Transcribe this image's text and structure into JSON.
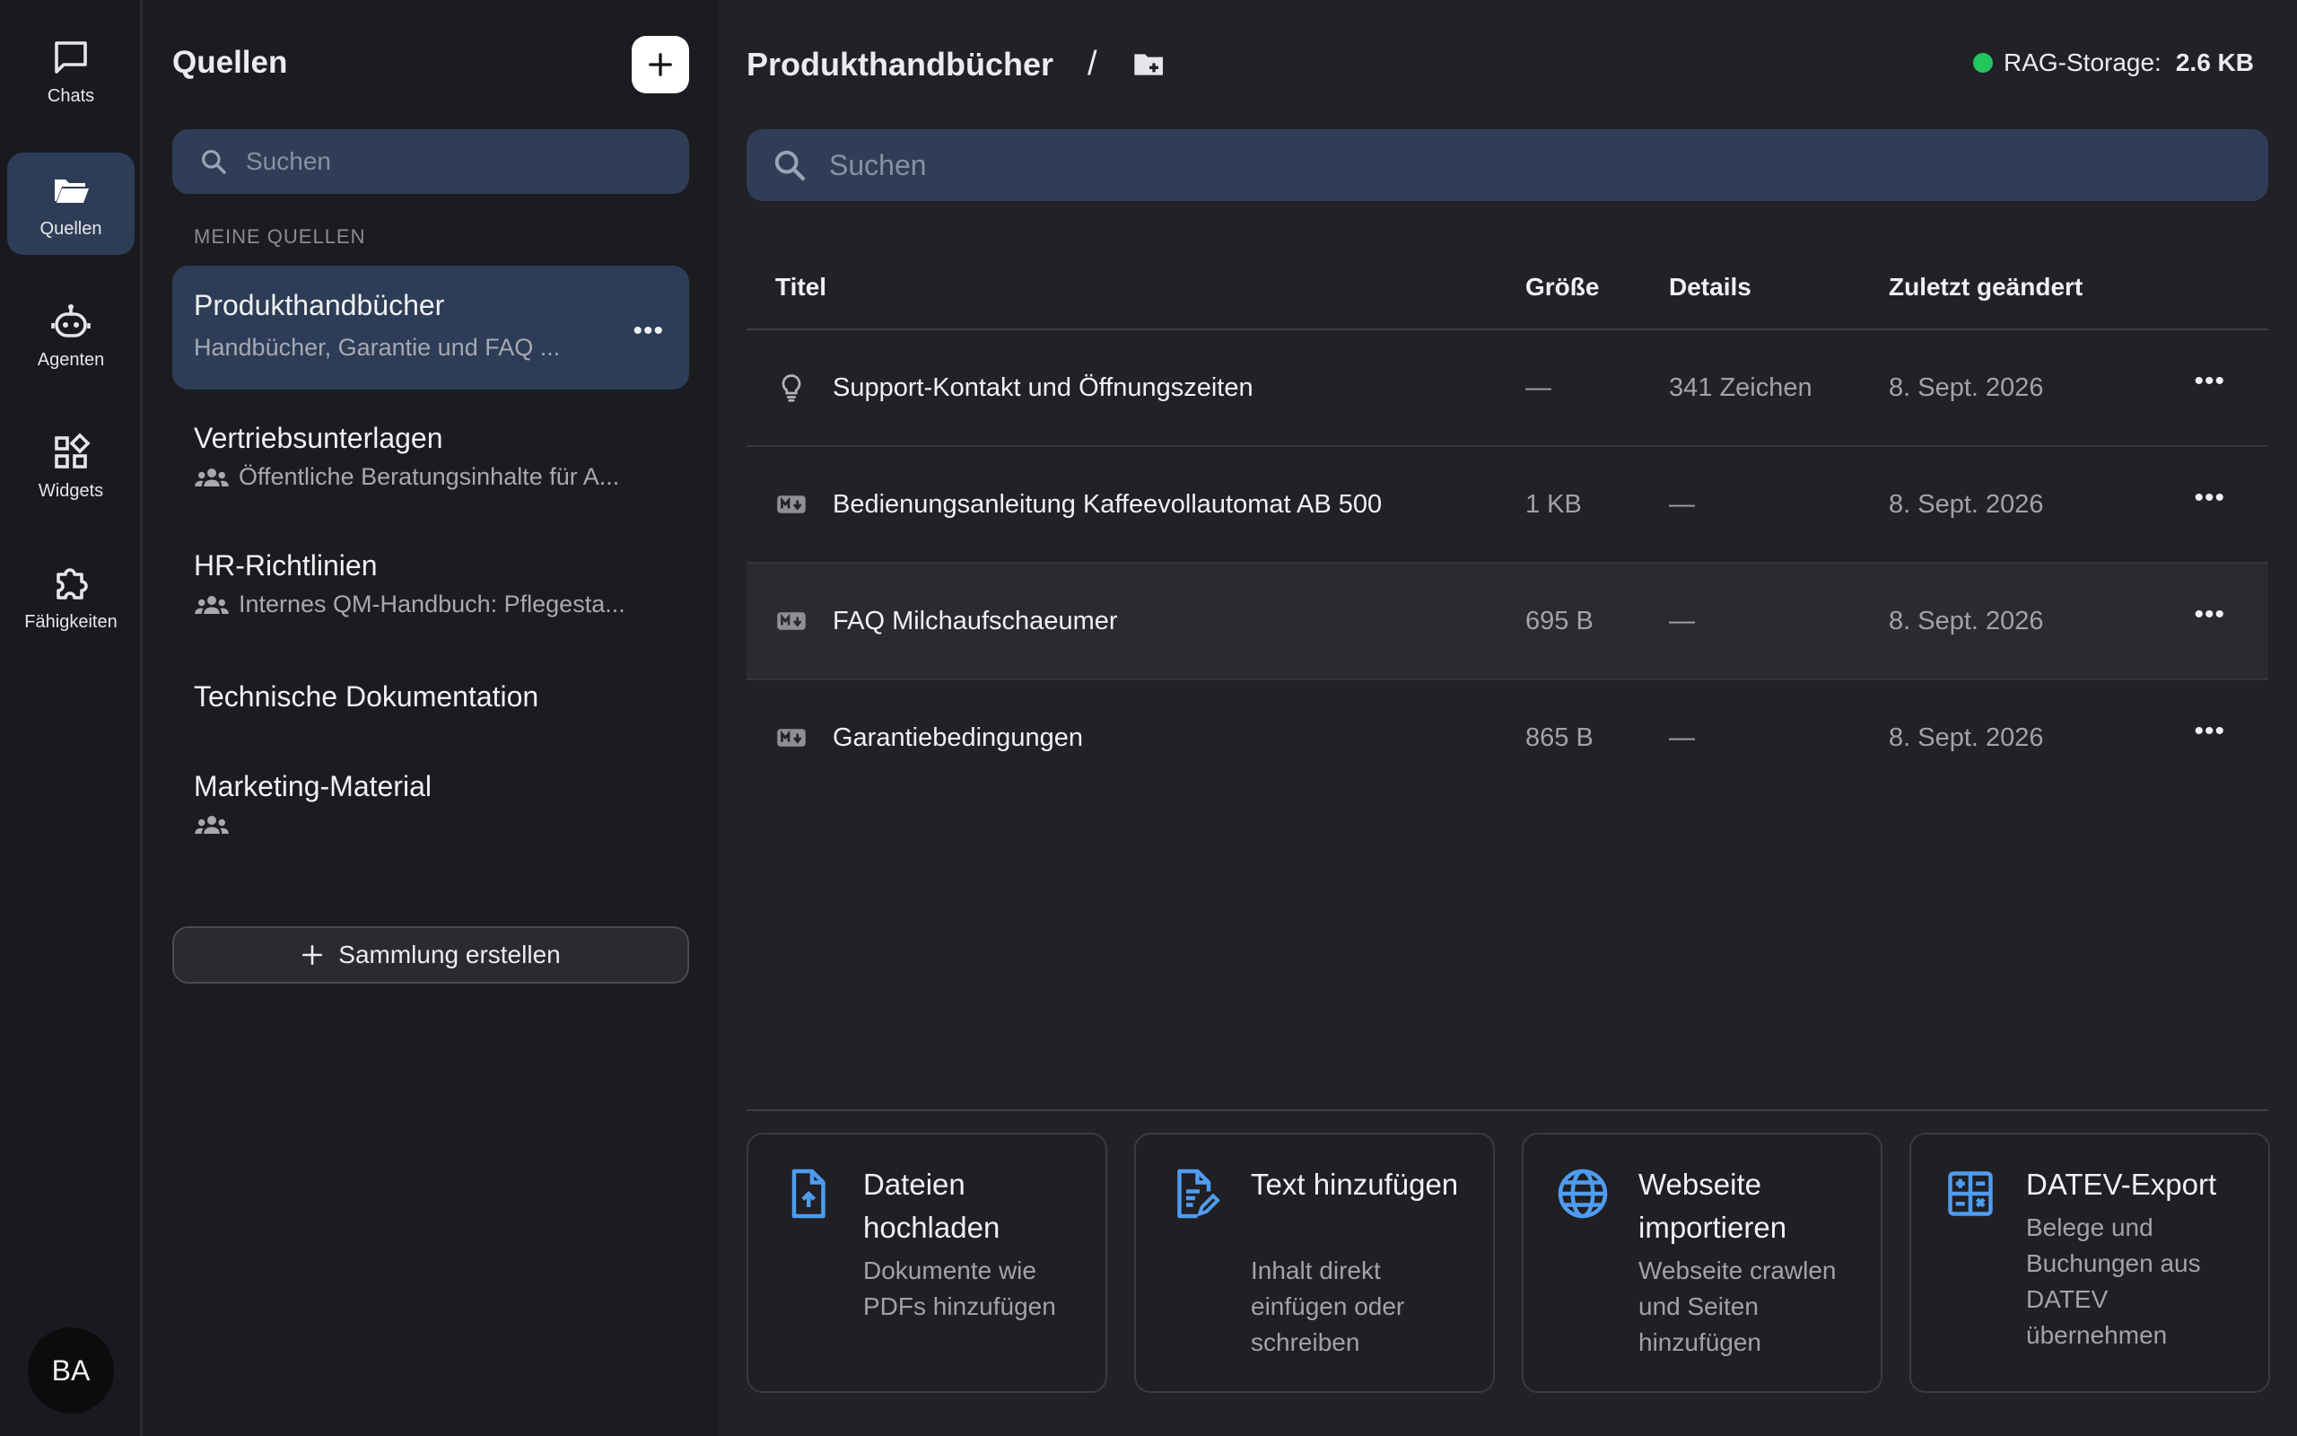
{
  "rail": {
    "items": [
      {
        "label": "Chats",
        "icon": "chat-icon"
      },
      {
        "label": "Quellen",
        "icon": "folder-open-icon",
        "active": true
      },
      {
        "label": "Agenten",
        "icon": "robot-icon"
      },
      {
        "label": "Widgets",
        "icon": "widgets-icon"
      },
      {
        "label": "Fähigkeiten",
        "icon": "puzzle-icon"
      }
    ],
    "avatar": "BA"
  },
  "sources": {
    "title": "Quellen",
    "search_placeholder": "Suchen",
    "section_label": "MEINE QUELLEN",
    "collections": [
      {
        "name": "Produkthandbücher",
        "description": "Handbücher, Garantie und FAQ ...",
        "active": true,
        "shared": false
      },
      {
        "name": "Vertriebsunterlagen",
        "description": "Öffentliche Beratungsinhalte für A...",
        "shared": true
      },
      {
        "name": "HR-Richtlinien",
        "description": "Internes QM-Handbuch: Pflegesta...",
        "shared": true
      },
      {
        "name": "Technische Dokumentation",
        "description": "",
        "shared": false
      },
      {
        "name": "Marketing-Material",
        "description": "",
        "shared": true
      }
    ],
    "create_label": "Sammlung erstellen"
  },
  "main": {
    "breadcrumb": "Produkthandbücher",
    "separator": "/",
    "storage_label": "RAG-Storage:",
    "storage_value": "2.6 KB",
    "status_color": "#22c55e",
    "search_placeholder": "Suchen",
    "columns": {
      "title": "Titel",
      "size": "Größe",
      "details": "Details",
      "modified": "Zuletzt geändert"
    },
    "rows": [
      {
        "icon": "lightbulb-icon",
        "title": "Support-Kontakt und Öffnungszeiten",
        "size": "—",
        "details": "341 Zeichen",
        "modified": "8. Sept. 2026"
      },
      {
        "icon": "markdown-icon",
        "title": "Bedienungsanleitung Kaffeevollautomat AB 500",
        "size": "1 KB",
        "details": "—",
        "modified": "8. Sept. 2026"
      },
      {
        "icon": "markdown-icon",
        "title": "FAQ Milchaufschaeumer",
        "size": "695 B",
        "details": "—",
        "modified": "8. Sept. 2026"
      },
      {
        "icon": "markdown-icon",
        "title": "Garantiebedingungen",
        "size": "865 B",
        "details": "—",
        "modified": "8. Sept. 2026"
      }
    ],
    "cards": [
      {
        "title": "Dateien hochladen",
        "desc": "Dokumente wie PDFs hinzufügen",
        "icon": "file-upload-icon"
      },
      {
        "title": "Text hinzufügen",
        "desc": "Inhalt direkt einfügen oder schreiben",
        "icon": "file-edit-icon"
      },
      {
        "title": "Webseite importieren",
        "desc": "Webseite crawlen und Seiten hinzufügen",
        "icon": "globe-icon"
      },
      {
        "title": "DATEV-Export",
        "desc": "Belege und Buchungen aus DATEV übernehmen",
        "icon": "calculator-icon"
      }
    ],
    "accent_color": "#4f9cf0"
  }
}
